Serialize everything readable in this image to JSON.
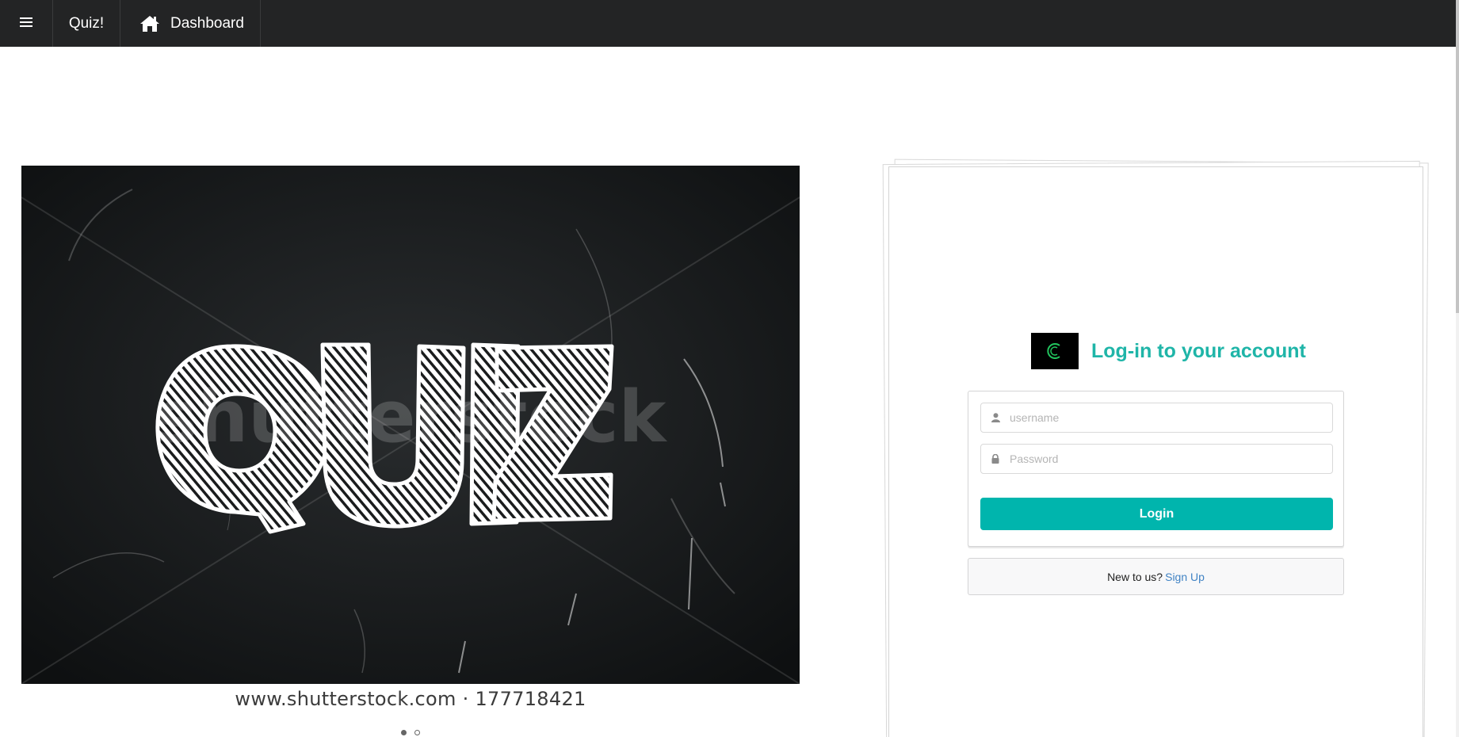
{
  "navbar": {
    "menu_icon": "hamburger-icon",
    "brand_label": "Quiz!",
    "dashboard_icon": "home-icon",
    "dashboard_label": "Dashboard",
    "background_color": "#232425"
  },
  "carousel": {
    "slide_image": {
      "big_word": "QUIZ",
      "watermark": "shutterstock"
    },
    "caption": "www.shutterstock.com · 177718421",
    "indicators": [
      {
        "active": true
      },
      {
        "active": false
      }
    ]
  },
  "login": {
    "logo_letter": "C",
    "title": "Log-in to your account",
    "title_color": "#1fb5a8",
    "username_placeholder": "username",
    "username_icon": "user-icon",
    "password_placeholder": "Password",
    "password_icon": "lock-icon",
    "login_button_label": "Login",
    "button_color": "#00b5ad",
    "signup_prompt": "New to us?",
    "signup_link": "Sign Up",
    "link_color": "#4183c4"
  }
}
